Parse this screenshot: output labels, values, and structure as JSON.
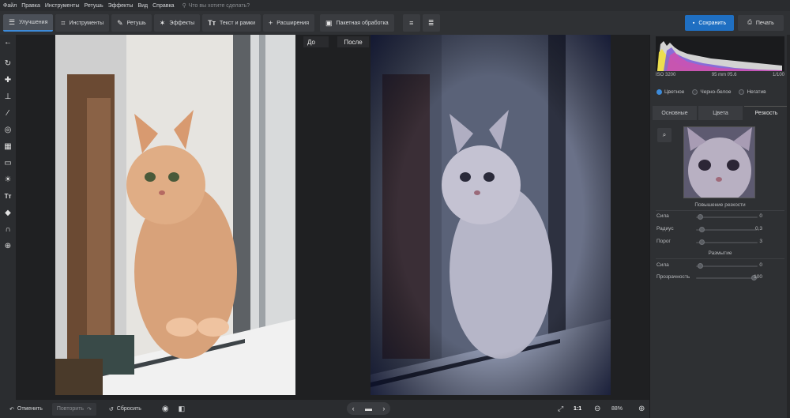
{
  "menu": {
    "items": [
      "Файл",
      "Правка",
      "Инструменты",
      "Ретушь",
      "Эффекты",
      "Вид",
      "Справка"
    ],
    "search_placeholder": "Что вы хотите сделать?"
  },
  "toolbar": {
    "tabs": [
      {
        "label": "Улучшения",
        "icon": "sliders-icon"
      },
      {
        "label": "Инструменты",
        "icon": "crop-icon"
      },
      {
        "label": "Ретушь",
        "icon": "brush-icon"
      },
      {
        "label": "Эффекты",
        "icon": "magic-wand-icon"
      },
      {
        "label": "Текст и рамки",
        "icon": "text-icon"
      },
      {
        "label": "Расширения",
        "icon": "plus-icon"
      }
    ],
    "batch_label": "Пакетная обработка",
    "save_label": "Сохранить",
    "print_label": "Печать"
  },
  "canvas": {
    "before_label": "До",
    "after_label": "После"
  },
  "bottombar": {
    "undo_label": "Отменить",
    "redo_label": "Повторить",
    "reset_label": "Сбросить",
    "ratio_label": "1:1",
    "zoom_label": "88%"
  },
  "panel": {
    "exif": {
      "iso": "ISO 3200",
      "lens": "95 mm f/5.6",
      "shutter": "1/100"
    },
    "color_modes": [
      {
        "label": "Цветное",
        "selected": true
      },
      {
        "label": "Черно-белое",
        "selected": false
      },
      {
        "label": "Негатив",
        "selected": false
      }
    ],
    "tabs": [
      "Основные",
      "Цвета",
      "Резкость"
    ],
    "active_tab": "Резкость",
    "sharpen_title": "Повышение резкости",
    "sharpen": [
      {
        "label": "Сила",
        "value": "0",
        "level": 0
      },
      {
        "label": "Радиус",
        "value": "0,3",
        "level": 0.03
      },
      {
        "label": "Порог",
        "value": "3",
        "level": 0.03
      }
    ],
    "blur_title": "Размытие",
    "blur": [
      {
        "label": "Сила",
        "value": "0",
        "level": 0
      },
      {
        "label": "Прозрачность",
        "value": "100",
        "level": 1.0
      }
    ]
  }
}
